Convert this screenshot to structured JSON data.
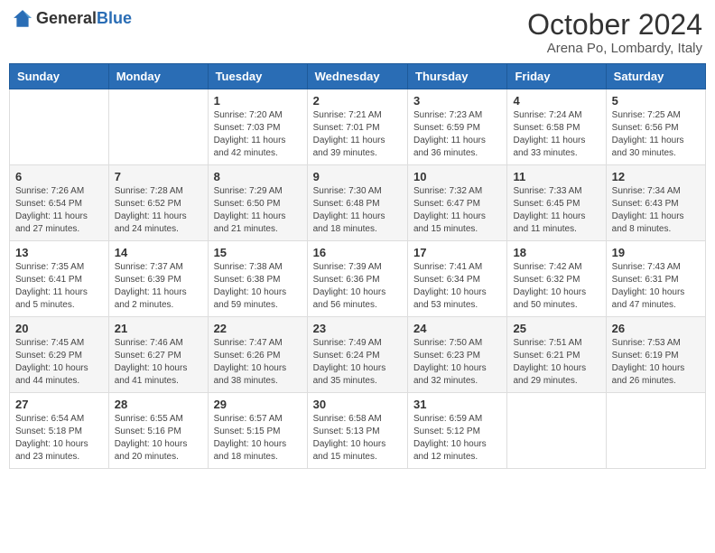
{
  "header": {
    "logo_general": "General",
    "logo_blue": "Blue",
    "month_title": "October 2024",
    "location": "Arena Po, Lombardy, Italy"
  },
  "weekdays": [
    "Sunday",
    "Monday",
    "Tuesday",
    "Wednesday",
    "Thursday",
    "Friday",
    "Saturday"
  ],
  "weeks": [
    [
      {
        "day": "",
        "info": ""
      },
      {
        "day": "",
        "info": ""
      },
      {
        "day": "1",
        "info": "Sunrise: 7:20 AM\nSunset: 7:03 PM\nDaylight: 11 hours and 42 minutes."
      },
      {
        "day": "2",
        "info": "Sunrise: 7:21 AM\nSunset: 7:01 PM\nDaylight: 11 hours and 39 minutes."
      },
      {
        "day": "3",
        "info": "Sunrise: 7:23 AM\nSunset: 6:59 PM\nDaylight: 11 hours and 36 minutes."
      },
      {
        "day": "4",
        "info": "Sunrise: 7:24 AM\nSunset: 6:58 PM\nDaylight: 11 hours and 33 minutes."
      },
      {
        "day": "5",
        "info": "Sunrise: 7:25 AM\nSunset: 6:56 PM\nDaylight: 11 hours and 30 minutes."
      }
    ],
    [
      {
        "day": "6",
        "info": "Sunrise: 7:26 AM\nSunset: 6:54 PM\nDaylight: 11 hours and 27 minutes."
      },
      {
        "day": "7",
        "info": "Sunrise: 7:28 AM\nSunset: 6:52 PM\nDaylight: 11 hours and 24 minutes."
      },
      {
        "day": "8",
        "info": "Sunrise: 7:29 AM\nSunset: 6:50 PM\nDaylight: 11 hours and 21 minutes."
      },
      {
        "day": "9",
        "info": "Sunrise: 7:30 AM\nSunset: 6:48 PM\nDaylight: 11 hours and 18 minutes."
      },
      {
        "day": "10",
        "info": "Sunrise: 7:32 AM\nSunset: 6:47 PM\nDaylight: 11 hours and 15 minutes."
      },
      {
        "day": "11",
        "info": "Sunrise: 7:33 AM\nSunset: 6:45 PM\nDaylight: 11 hours and 11 minutes."
      },
      {
        "day": "12",
        "info": "Sunrise: 7:34 AM\nSunset: 6:43 PM\nDaylight: 11 hours and 8 minutes."
      }
    ],
    [
      {
        "day": "13",
        "info": "Sunrise: 7:35 AM\nSunset: 6:41 PM\nDaylight: 11 hours and 5 minutes."
      },
      {
        "day": "14",
        "info": "Sunrise: 7:37 AM\nSunset: 6:39 PM\nDaylight: 11 hours and 2 minutes."
      },
      {
        "day": "15",
        "info": "Sunrise: 7:38 AM\nSunset: 6:38 PM\nDaylight: 10 hours and 59 minutes."
      },
      {
        "day": "16",
        "info": "Sunrise: 7:39 AM\nSunset: 6:36 PM\nDaylight: 10 hours and 56 minutes."
      },
      {
        "day": "17",
        "info": "Sunrise: 7:41 AM\nSunset: 6:34 PM\nDaylight: 10 hours and 53 minutes."
      },
      {
        "day": "18",
        "info": "Sunrise: 7:42 AM\nSunset: 6:32 PM\nDaylight: 10 hours and 50 minutes."
      },
      {
        "day": "19",
        "info": "Sunrise: 7:43 AM\nSunset: 6:31 PM\nDaylight: 10 hours and 47 minutes."
      }
    ],
    [
      {
        "day": "20",
        "info": "Sunrise: 7:45 AM\nSunset: 6:29 PM\nDaylight: 10 hours and 44 minutes."
      },
      {
        "day": "21",
        "info": "Sunrise: 7:46 AM\nSunset: 6:27 PM\nDaylight: 10 hours and 41 minutes."
      },
      {
        "day": "22",
        "info": "Sunrise: 7:47 AM\nSunset: 6:26 PM\nDaylight: 10 hours and 38 minutes."
      },
      {
        "day": "23",
        "info": "Sunrise: 7:49 AM\nSunset: 6:24 PM\nDaylight: 10 hours and 35 minutes."
      },
      {
        "day": "24",
        "info": "Sunrise: 7:50 AM\nSunset: 6:23 PM\nDaylight: 10 hours and 32 minutes."
      },
      {
        "day": "25",
        "info": "Sunrise: 7:51 AM\nSunset: 6:21 PM\nDaylight: 10 hours and 29 minutes."
      },
      {
        "day": "26",
        "info": "Sunrise: 7:53 AM\nSunset: 6:19 PM\nDaylight: 10 hours and 26 minutes."
      }
    ],
    [
      {
        "day": "27",
        "info": "Sunrise: 6:54 AM\nSunset: 5:18 PM\nDaylight: 10 hours and 23 minutes."
      },
      {
        "day": "28",
        "info": "Sunrise: 6:55 AM\nSunset: 5:16 PM\nDaylight: 10 hours and 20 minutes."
      },
      {
        "day": "29",
        "info": "Sunrise: 6:57 AM\nSunset: 5:15 PM\nDaylight: 10 hours and 18 minutes."
      },
      {
        "day": "30",
        "info": "Sunrise: 6:58 AM\nSunset: 5:13 PM\nDaylight: 10 hours and 15 minutes."
      },
      {
        "day": "31",
        "info": "Sunrise: 6:59 AM\nSunset: 5:12 PM\nDaylight: 10 hours and 12 minutes."
      },
      {
        "day": "",
        "info": ""
      },
      {
        "day": "",
        "info": ""
      }
    ]
  ]
}
